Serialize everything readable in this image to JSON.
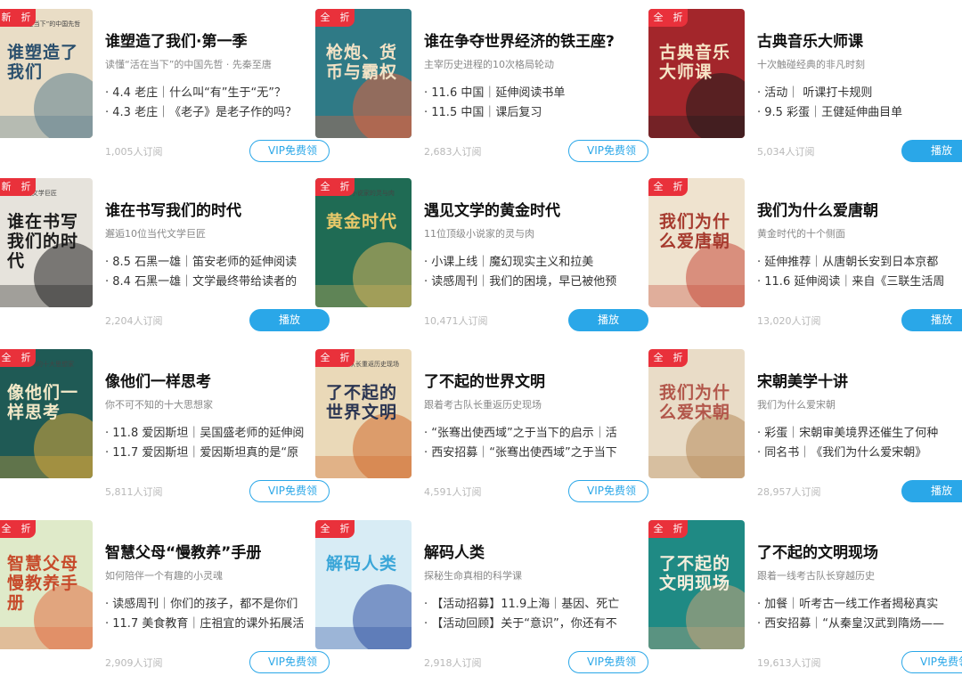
{
  "courses": [
    {
      "cover_title": "谁塑造了我们",
      "cover_sub": "读懂“活在当下”的中国先哲",
      "cover_color": "#e9ddc6",
      "cover_accent": "#5a7b8c",
      "cover_text": "#2a4f6d",
      "badges": [
        "新",
        "折"
      ],
      "title": "谁塑造了我们·第一季",
      "subtitle": "读懂“活在当下”的中国先哲 · 先秦至唐",
      "items": [
        "4.4 老庄｜什么叫“有”生于“无”？",
        "4.3 老庄｜《老子》是老子作的吗？"
      ],
      "subs": "1,005人订阅",
      "button": "VIP免费领",
      "btn_type": "vip"
    },
    {
      "cover_title": "枪炮、货币与霸权",
      "cover_sub": "",
      "cover_color": "#2f7a86",
      "cover_accent": "#e3603d",
      "cover_text": "#f4e3c6",
      "badges": [
        "全",
        "折"
      ],
      "title": "谁在争夺世界经济的铁王座?",
      "subtitle": "主宰历史进程的10次格局轮动",
      "items": [
        "11.6 中国｜延伸阅读书单",
        "11.5 中国｜课后复习"
      ],
      "subs": "2,683人订阅",
      "button": "VIP免费领",
      "btn_type": "vip"
    },
    {
      "cover_title": "古典音乐大师课",
      "cover_sub": "",
      "cover_color": "#a3262b",
      "cover_accent": "#1c1c1c",
      "cover_text": "#f6e6c8",
      "badges": [
        "全",
        "折"
      ],
      "title": "古典音乐大师课",
      "subtitle": "十次触碰经典的非凡时刻",
      "items": [
        "活动｜ 听课打卡规则",
        "9.5 彩蛋｜王健延伸曲目单"
      ],
      "subs": "5,034人订阅",
      "button": "播放",
      "btn_type": "play"
    },
    {
      "cover_title": "谁在书写我们的时代",
      "cover_sub": "10位当代文学巨匠",
      "cover_color": "#e6e3dc",
      "cover_accent": "#1f1f1f",
      "cover_text": "#1b1b1b",
      "badges": [
        "新",
        "折"
      ],
      "title": "谁在书写我们的时代",
      "subtitle": "邂逅10位当代文学巨匠",
      "items": [
        "8.5 石黑一雄｜笛安老师的延伸阅读",
        "8.4 石黑一雄｜文学最终带给读者的"
      ],
      "subs": "2,204人订阅",
      "button": "播放",
      "btn_type": "play"
    },
    {
      "cover_title": "黄金时代",
      "cover_sub": "11位顶级小说家的灵与肉",
      "cover_color": "#1f6b54",
      "cover_accent": "#d7b55b",
      "cover_text": "#e9c96a",
      "badges": [
        "全",
        "折"
      ],
      "title": "遇见文学的黄金时代",
      "subtitle": "11位顶级小说家的灵与肉",
      "items": [
        "小课上线｜魔幻现实主义和拉美",
        "读感周刊｜我们的困境，早已被他预"
      ],
      "subs": "10,471人订阅",
      "button": "播放",
      "btn_type": "play"
    },
    {
      "cover_title": "我们为什么爱唐朝",
      "cover_sub": "",
      "cover_color": "#efe3cf",
      "cover_accent": "#c74a3a",
      "cover_text": "#a63a2e",
      "badges": [
        "全",
        "折"
      ],
      "title": "我们为什么爱唐朝",
      "subtitle": "黄金时代的十个侧面",
      "items": [
        "延伸推荐｜从唐朝长安到日本京都",
        "11.6 延伸阅读｜来自《三联生活周"
      ],
      "subs": "13,020人订阅",
      "button": "播放",
      "btn_type": "play"
    },
    {
      "cover_title": "像他们一样思考",
      "cover_sub": "你不可不知的十大思想家",
      "cover_color": "#1f5a55",
      "cover_accent": "#d9a73a",
      "cover_text": "#f3e9c8",
      "badges": [
        "全",
        "折"
      ],
      "title": "像他们一样思考",
      "subtitle": "你不可不知的十大思想家",
      "items": [
        "11.8 爱因斯坦｜吴国盛老师的延伸阅",
        "11.7 爱因斯坦｜爱因斯坦真的是“原"
      ],
      "subs": "5,811人订阅",
      "button": "VIP免费领",
      "btn_type": "vip"
    },
    {
      "cover_title": "了不起的世界文明",
      "cover_sub": "跟着考古队长重返历史现场",
      "cover_color": "#ead9b8",
      "cover_accent": "#d06a2c",
      "cover_text": "#2b3552",
      "badges": [
        "全",
        "折"
      ],
      "title": "了不起的世界文明",
      "subtitle": "跟着考古队长重返历史现场",
      "items": [
        "“张骞出使西域”之于当下的启示｜活",
        "西安招募｜“张骞出使西域”之于当下"
      ],
      "subs": "4,591人订阅",
      "button": "VIP免费领",
      "btn_type": "vip"
    },
    {
      "cover_title": "我们为什么爱宋朝",
      "cover_sub": "",
      "cover_color": "#e9dcc7",
      "cover_accent": "#b78a5a",
      "cover_text": "#b2564a",
      "badges": [
        "全",
        "折"
      ],
      "title": "宋朝美学十讲",
      "subtitle": "我们为什么爱宋朝",
      "items": [
        "彩蛋｜宋朝审美境界还催生了何种",
        "同名书｜《我们为什么爱宋朝》"
      ],
      "subs": "28,957人订阅",
      "button": "播放",
      "btn_type": "play"
    },
    {
      "cover_title": "智慧父母慢教养手册",
      "cover_sub": "",
      "cover_color": "#dfeac9",
      "cover_accent": "#e26b3f",
      "cover_text": "#c74a2a",
      "badges": [
        "全",
        "折"
      ],
      "title": "智慧父母“慢教养”手册",
      "subtitle": "如何陪伴一个有趣的小灵魂",
      "items": [
        "读感周刊｜你们的孩子，都不是你们",
        "11.7 美食教育｜庄祖宜的课外拓展活"
      ],
      "subs": "2,909人订阅",
      "button": "VIP免费领",
      "btn_type": "vip"
    },
    {
      "cover_title": "解码人类",
      "cover_sub": "",
      "cover_color": "#d8ecf5",
      "cover_accent": "#2d4fa0",
      "cover_text": "#3aa6d8",
      "badges": [
        "全",
        "折"
      ],
      "title": "解码人类",
      "subtitle": "探秘生命真相的科学课",
      "items": [
        "【活动招募】11.9上海｜基因、死亡",
        "【活动回顾】关于“意识”，你还有不"
      ],
      "subs": "2,918人订阅",
      "button": "VIP免费领",
      "btn_type": "vip"
    },
    {
      "cover_title": "了不起的文明现场",
      "cover_sub": "",
      "cover_color": "#1f8a84",
      "cover_accent": "#c9a47a",
      "cover_text": "#f5eedc",
      "badges": [
        "全",
        "折"
      ],
      "title": "了不起的文明现场",
      "subtitle": "跟着一线考古队长穿越历史",
      "items": [
        "加餐｜听考古一线工作者揭秘真实",
        "西安招募｜“从秦皇汉武到隋炀——"
      ],
      "subs": "19,613人订阅",
      "button": "VIP免费领",
      "btn_type": "vip"
    }
  ]
}
